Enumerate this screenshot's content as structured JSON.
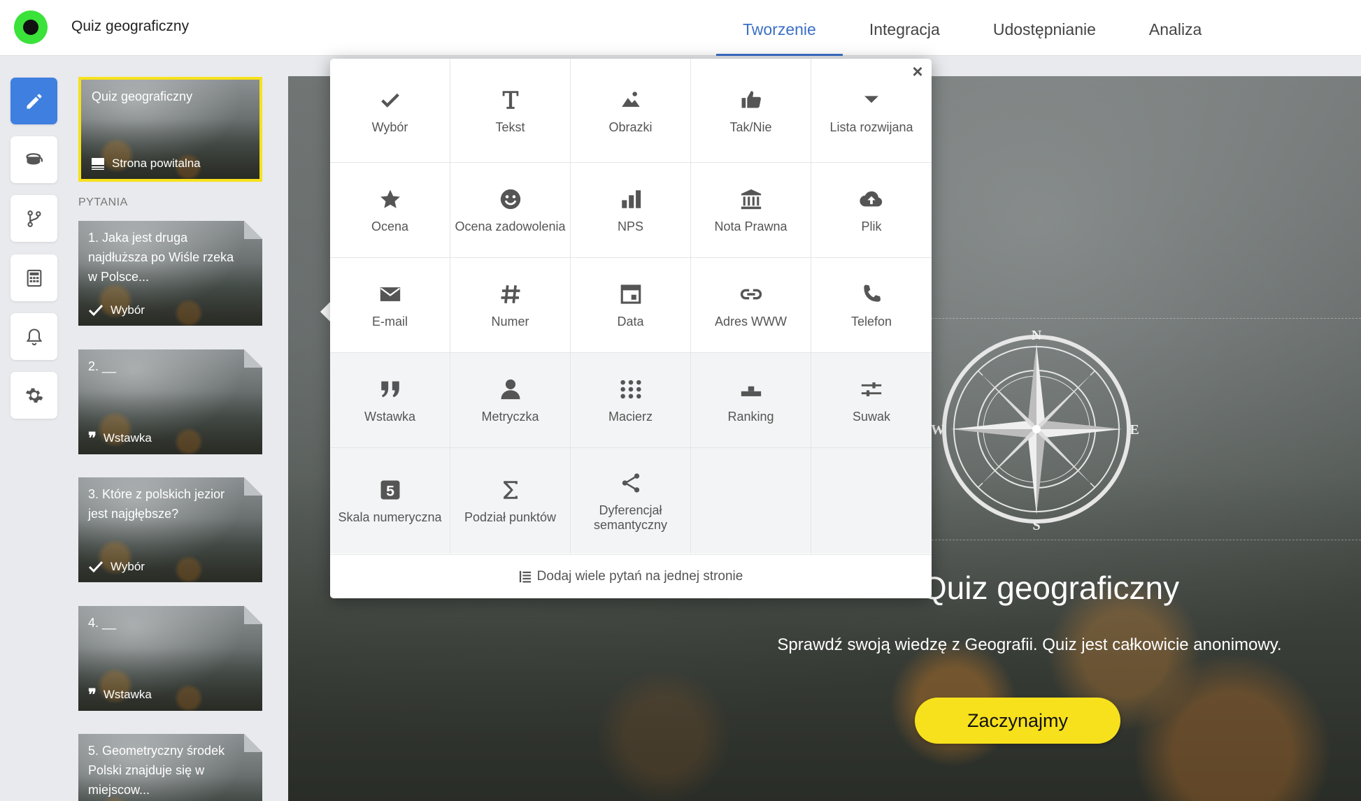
{
  "app": {
    "title": "Quiz geograficzny"
  },
  "tabs": [
    {
      "label": "Tworzenie",
      "active": true
    },
    {
      "label": "Integracja",
      "active": false
    },
    {
      "label": "Udostępnianie",
      "active": false
    },
    {
      "label": "Analiza",
      "active": false
    }
  ],
  "rail": [
    {
      "icon": "pencil-icon",
      "active": true
    },
    {
      "icon": "paint-bucket-icon",
      "active": false
    },
    {
      "icon": "branch-logic-icon",
      "active": false
    },
    {
      "icon": "calculator-icon",
      "active": false
    },
    {
      "icon": "bell-icon",
      "active": false
    },
    {
      "icon": "gear-icon",
      "active": false
    }
  ],
  "slides": {
    "welcome": {
      "title": "Quiz geograficzny",
      "type": "Strona powitalna"
    },
    "section_label": "PYTANIA",
    "questions": [
      {
        "title": "1. Jaka jest druga najdłuższa po Wiśle rzeka w Polsce...",
        "type": "Wybór",
        "type_icon": "check-icon"
      },
      {
        "title": "2. __",
        "type": "Wstawka",
        "type_icon": "quote-icon"
      },
      {
        "title": "3. Które z polskich jezior jest najgłębsze?",
        "type": "Wybór",
        "type_icon": "check-icon"
      },
      {
        "title": "4. __",
        "type": "Wstawka",
        "type_icon": "quote-icon"
      },
      {
        "title": "5. Geometryczny środek Polski znajduje się w miejscow...",
        "type": "",
        "type_icon": ""
      }
    ]
  },
  "canvas": {
    "title": "Quiz geograficzny",
    "subtitle": "Sprawdź swoją wiedzę z Geografii. Quiz jest całkowicie anonimowy.",
    "start_button": "Zaczynajmy",
    "compass_letters": {
      "n": "N",
      "s": "S",
      "e": "E",
      "w": "W"
    }
  },
  "picker": {
    "close_label": "×",
    "items": [
      {
        "label": "Wybór",
        "icon": "check-icon"
      },
      {
        "label": "Tekst",
        "icon": "text-t-icon"
      },
      {
        "label": "Obrazki",
        "icon": "images-icon"
      },
      {
        "label": "Tak/Nie",
        "icon": "thumbs-up-icon"
      },
      {
        "label": "Lista rozwijana",
        "icon": "dropdown-caret-icon"
      },
      {
        "label": "Ocena",
        "icon": "star-icon"
      },
      {
        "label": "Ocena zadowolenia",
        "icon": "smiley-icon"
      },
      {
        "label": "NPS",
        "icon": "bar-chart-icon"
      },
      {
        "label": "Nota Prawna",
        "icon": "institution-icon"
      },
      {
        "label": "Plik",
        "icon": "cloud-upload-icon"
      },
      {
        "label": "E-mail",
        "icon": "envelope-icon"
      },
      {
        "label": "Numer",
        "icon": "hash-icon"
      },
      {
        "label": "Data",
        "icon": "calendar-icon"
      },
      {
        "label": "Adres WWW",
        "icon": "link-icon"
      },
      {
        "label": "Telefon",
        "icon": "phone-icon"
      },
      {
        "label": "Wstawka",
        "icon": "quote-icon"
      },
      {
        "label": "Metryczka",
        "icon": "user-icon"
      },
      {
        "label": "Macierz",
        "icon": "dot-grid-icon"
      },
      {
        "label": "Ranking",
        "icon": "podium-icon"
      },
      {
        "label": "Suwak",
        "icon": "slider-icon"
      },
      {
        "label": "Skala numeryczna",
        "icon": "number-five-icon"
      },
      {
        "label": "Podział punktów",
        "icon": "sigma-icon"
      },
      {
        "label": "Dyferencjał semantyczny",
        "icon": "share-nodes-icon"
      }
    ],
    "footer": "Dodaj wiele pytań na jednej stronie"
  }
}
